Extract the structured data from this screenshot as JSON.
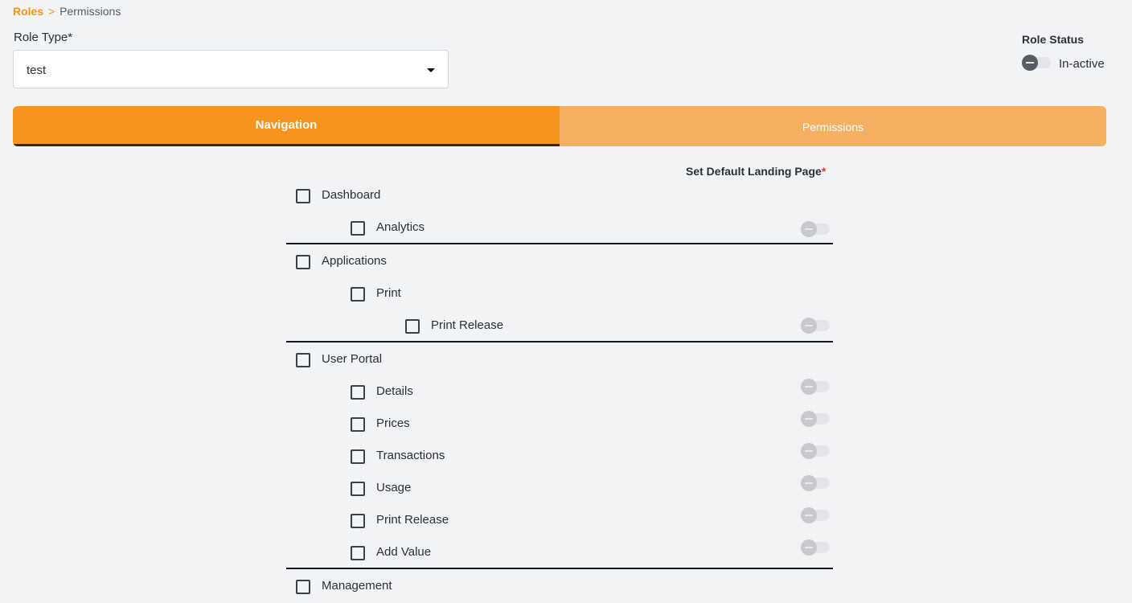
{
  "breadcrumb": {
    "root": "Roles",
    "separator": ">",
    "current": "Permissions"
  },
  "role_type": {
    "label": "Role Type*",
    "value": "test",
    "caret_icon": "caret-down-icon"
  },
  "role_status": {
    "title": "Role Status",
    "value": "In-active",
    "enabled": false
  },
  "tabs": [
    {
      "label": "Navigation",
      "active": true
    },
    {
      "label": "Permissions",
      "active": false
    }
  ],
  "landing_header": {
    "label": "Set Default Landing Page",
    "required_mark": "*"
  },
  "tree": {
    "dashboard": {
      "label": "Dashboard",
      "checked": false
    },
    "analytics": {
      "label": "Analytics",
      "checked": false,
      "default_landing": false
    },
    "applications": {
      "label": "Applications",
      "checked": false
    },
    "print": {
      "label": "Print",
      "checked": false
    },
    "print_release_app": {
      "label": "Print Release",
      "checked": false,
      "default_landing": false
    },
    "user_portal": {
      "label": "User Portal",
      "checked": false
    },
    "details": {
      "label": "Details",
      "checked": false,
      "default_landing": false
    },
    "prices": {
      "label": "Prices",
      "checked": false,
      "default_landing": false
    },
    "transactions": {
      "label": "Transactions",
      "checked": false,
      "default_landing": false
    },
    "usage": {
      "label": "Usage",
      "checked": false,
      "default_landing": false
    },
    "print_release_portal": {
      "label": "Print Release",
      "checked": false,
      "default_landing": false
    },
    "add_value": {
      "label": "Add Value",
      "checked": false,
      "default_landing": false
    },
    "management": {
      "label": "Management",
      "checked": false
    }
  },
  "colors": {
    "accent": "#f7941d",
    "tab_inactive": "#f4b060",
    "background": "#f2f3f5",
    "required": "#d23b3b"
  }
}
